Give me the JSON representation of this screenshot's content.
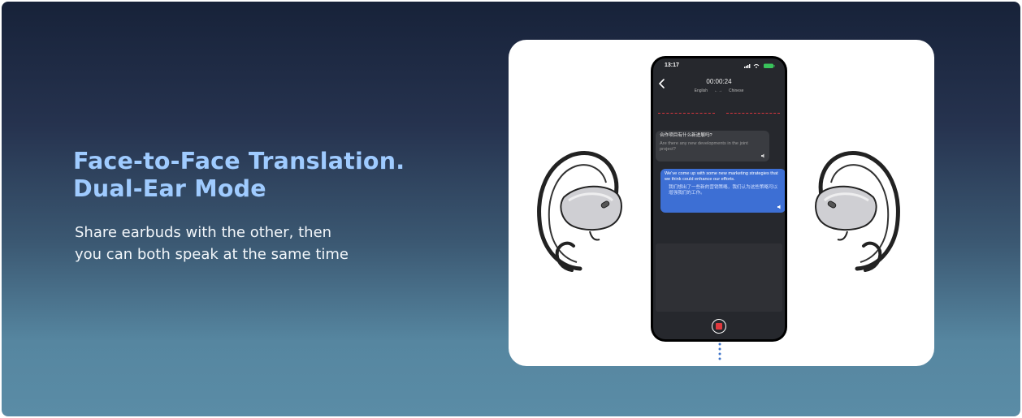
{
  "headline": {
    "line1": "Face-to-Face Translation.",
    "line2": "Dual-Ear Mode"
  },
  "subtitle": {
    "line1": "Share earbuds with the other, then",
    "line2": "you can both speak at the same time"
  },
  "phone": {
    "status_time": "13:17",
    "timer": "00:00:24",
    "lang_left": "English",
    "lang_arrow": "←→",
    "lang_right": "Chinese",
    "messages": [
      {
        "source": "合作项目有什么新进展吗?",
        "translation": "Are there any new developments in the joint project?"
      },
      {
        "source": "We've come up with some new marketing strategies that we think could enhance our efforts.",
        "translation": "我们想出了一些新的营销策略，我们认为这些策略可以增强我们的工作。"
      }
    ]
  },
  "colors": {
    "headline": "#9fcbff",
    "outgoing_bubble": "#3d6fd4",
    "record": "#e0393e"
  }
}
